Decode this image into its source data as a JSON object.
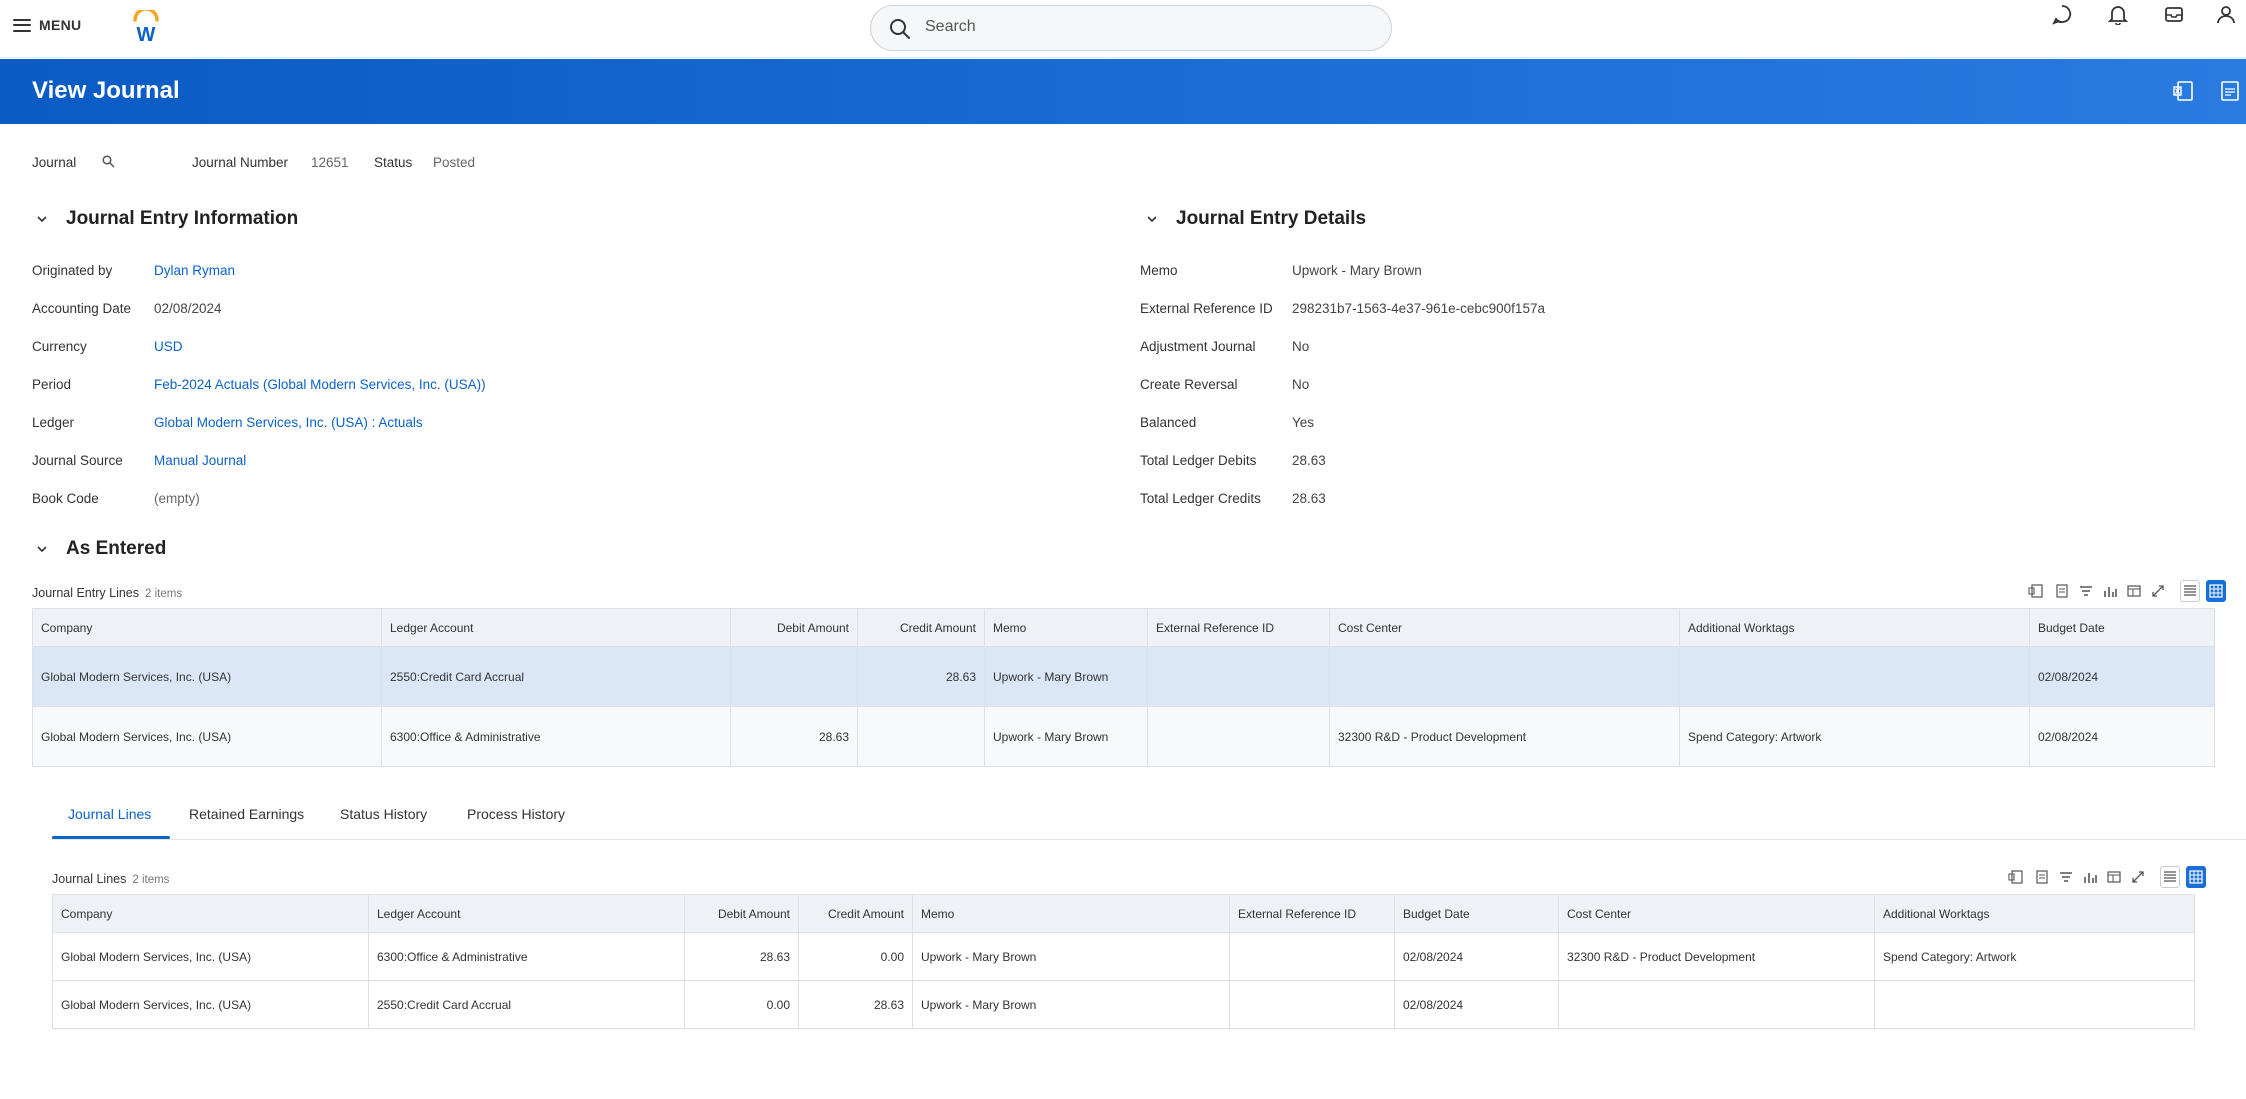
{
  "topbar": {
    "menu_label": "MENU",
    "logo_letter": "W",
    "search_placeholder": "Search",
    "icons": [
      "chat-icon",
      "bell-icon",
      "inbox-icon",
      "profile-icon"
    ]
  },
  "header": {
    "title": "View Journal",
    "icons": [
      "export-excel-icon",
      "export-pdf-icon"
    ],
    "color": "#0a5bc4"
  },
  "filter": {
    "journal_label": "Journal",
    "journal_number_label": "Journal Number",
    "journal_number_value": "12651",
    "status_label": "Status",
    "status_value": "Posted"
  },
  "info_section": {
    "title": "Journal Entry Information",
    "fields": [
      {
        "label": "Originated by",
        "value": "Dylan Ryman",
        "link": true
      },
      {
        "label": "Accounting Date",
        "value": "02/08/2024",
        "link": false
      },
      {
        "label": "Currency",
        "value": "USD",
        "link": true
      },
      {
        "label": "Period",
        "value": "Feb-2024 Actuals (Global Modern Services, Inc. (USA))",
        "link": true
      },
      {
        "label": "Ledger",
        "value": "Global Modern Services, Inc. (USA) : Actuals",
        "link": true
      },
      {
        "label": "Journal Source",
        "value": "Manual Journal",
        "link": true
      },
      {
        "label": "Book Code",
        "value": "(empty)",
        "link": false
      }
    ]
  },
  "details_section": {
    "title": "Journal Entry Details",
    "fields": [
      {
        "label": "Memo",
        "value": "Upwork - Mary Brown"
      },
      {
        "label": "External Reference ID",
        "value": "298231b7-1563-4e37-961e-cebc900f157a"
      },
      {
        "label": "Adjustment Journal",
        "value": "No"
      },
      {
        "label": "Create Reversal",
        "value": "No"
      },
      {
        "label": "Balanced",
        "value": "Yes"
      },
      {
        "label": "Total Ledger Debits",
        "value": "28.63"
      },
      {
        "label": "Total Ledger Credits",
        "value": "28.63"
      }
    ]
  },
  "as_entered": {
    "title": "As Entered",
    "grid_label": "Journal Entry Lines",
    "grid_count": "2 items",
    "columns": [
      "Company",
      "Ledger Account",
      "Debit Amount",
      "Credit Amount",
      "Memo",
      "External Reference ID",
      "Cost Center",
      "Additional Worktags",
      "Budget Date"
    ],
    "rows": [
      [
        "Global Modern Services, Inc. (USA)",
        "2550:Credit Card Accrual",
        "",
        "28.63",
        "Upwork - Mary Brown",
        "",
        "",
        "",
        "02/08/2024"
      ],
      [
        "Global Modern Services, Inc. (USA)",
        "6300:Office & Administrative",
        "28.63",
        "",
        "Upwork - Mary Brown",
        "",
        "32300 R&D - Product Development",
        "Spend Category: Artwork",
        "02/08/2024"
      ]
    ]
  },
  "tabs": [
    "Journal Lines",
    "Retained Earnings",
    "Status History",
    "Process History"
  ],
  "journal_lines": {
    "grid_label": "Journal Lines",
    "grid_count": "2 items",
    "columns": [
      "Company",
      "Ledger Account",
      "Debit Amount",
      "Credit Amount",
      "Memo",
      "External Reference ID",
      "Budget Date",
      "Cost Center",
      "Additional Worktags"
    ],
    "rows": [
      [
        "Global Modern Services, Inc. (USA)",
        "6300:Office & Administrative",
        "28.63",
        "0.00",
        "Upwork - Mary Brown",
        "",
        "02/08/2024",
        "32300 R&D - Product Development",
        "Spend Category: Artwork"
      ],
      [
        "Global Modern Services, Inc. (USA)",
        "2550:Credit Card Accrual",
        "0.00",
        "28.63",
        "Upwork - Mary Brown",
        "",
        "02/08/2024",
        "",
        ""
      ]
    ]
  },
  "toolbar_icons": [
    "export-excel-icon",
    "export-pdf-icon",
    "filter-icon",
    "chart-icon",
    "column-config-icon",
    "fullscreen-icon",
    "table-view-icon",
    "grid-view-icon"
  ]
}
